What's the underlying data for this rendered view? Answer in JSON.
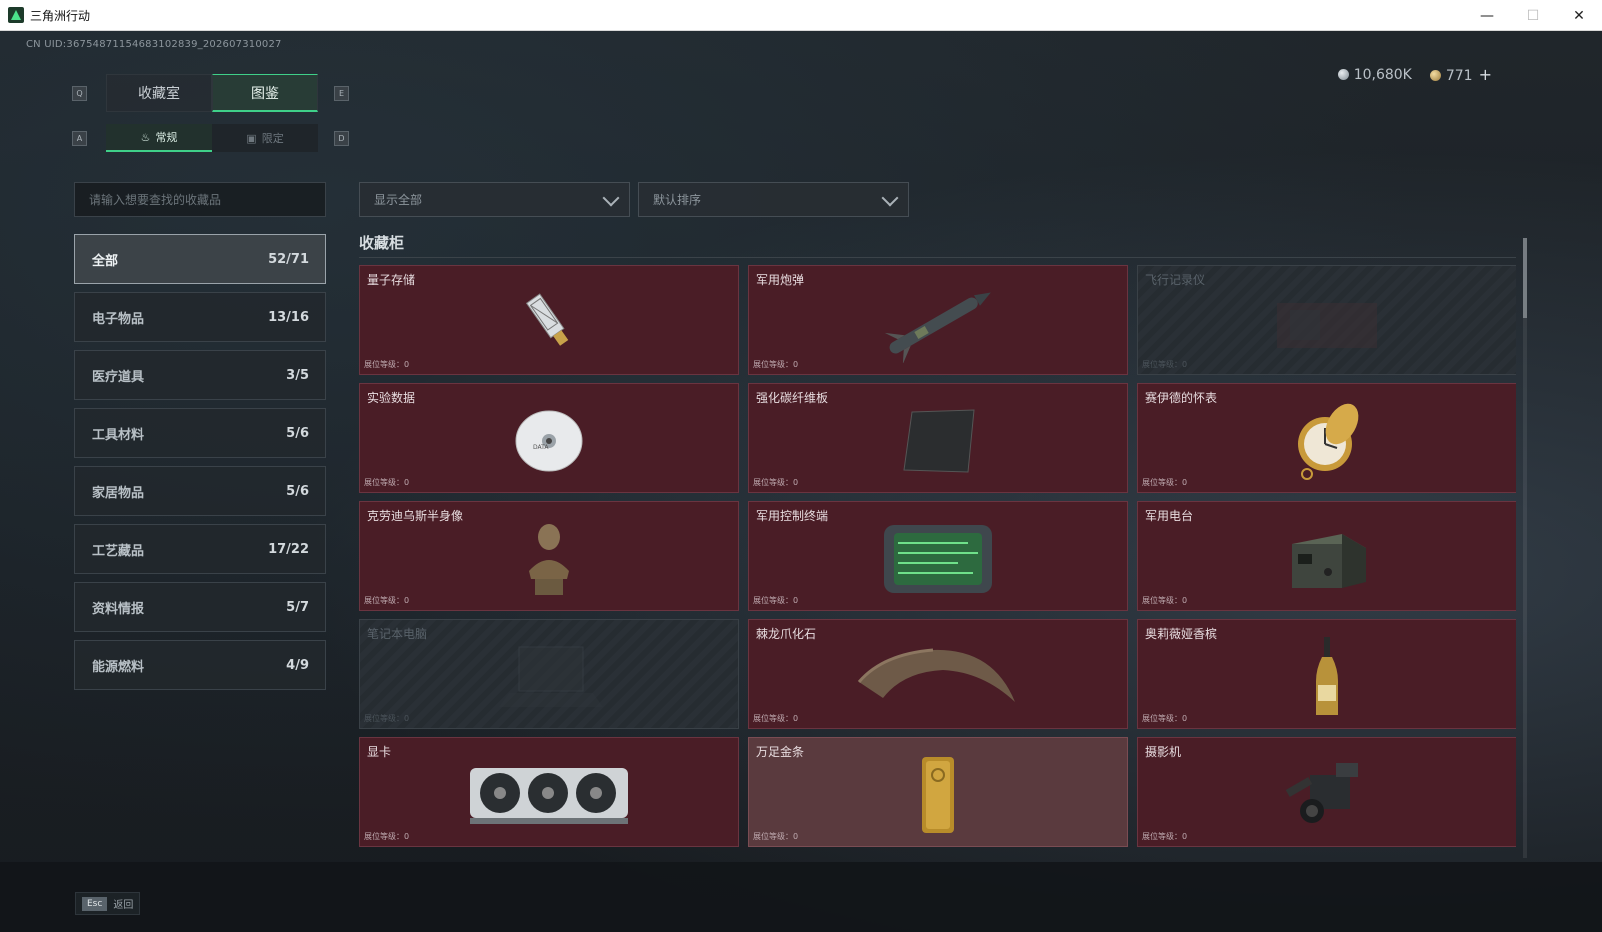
{
  "window": {
    "title": "三角洲行动",
    "minimize": "—",
    "maximize": "☐",
    "close": "✕"
  },
  "uid_text": "CN UID:36754871154683102839_202607310027",
  "currency": {
    "silver": "10,680K",
    "gold": "771",
    "add": "+"
  },
  "tabs": {
    "key_left": "Q",
    "key_right": "E",
    "items": [
      "收藏室",
      "图鉴"
    ],
    "active_index": 1
  },
  "subtabs": {
    "key_left": "A",
    "key_right": "D",
    "items": [
      "常规",
      "限定"
    ],
    "active_index": 0
  },
  "search": {
    "placeholder": "请输入想要查找的收藏品"
  },
  "filters": {
    "show": "显示全部",
    "sort": "默认排序"
  },
  "categories": [
    {
      "label": "全部",
      "count": "52/71",
      "active": true
    },
    {
      "label": "电子物品",
      "count": "13/16"
    },
    {
      "label": "医疗道具",
      "count": "3/5"
    },
    {
      "label": "工具材料",
      "count": "5/6"
    },
    {
      "label": "家居物品",
      "count": "5/6"
    },
    {
      "label": "工艺藏品",
      "count": "17/22"
    },
    {
      "label": "资料情报",
      "count": "5/7"
    },
    {
      "label": "能源燃料",
      "count": "4/9"
    }
  ],
  "section_title": "收藏柜",
  "level_label": "展位等级：0",
  "items": [
    {
      "name": "量子存储",
      "icon": "usb-drive-icon",
      "state": "owned"
    },
    {
      "name": "军用炮弹",
      "icon": "missile-icon",
      "state": "owned"
    },
    {
      "name": "飞行记录仪",
      "icon": "flight-recorder-icon",
      "state": "locked"
    },
    {
      "name": "实验数据",
      "icon": "disc-icon",
      "state": "owned"
    },
    {
      "name": "强化碳纤维板",
      "icon": "carbon-plate-icon",
      "state": "owned"
    },
    {
      "name": "赛伊德的怀表",
      "icon": "pocket-watch-icon",
      "state": "owned"
    },
    {
      "name": "克劳迪乌斯半身像",
      "icon": "bust-icon",
      "state": "owned"
    },
    {
      "name": "军用控制终端",
      "icon": "control-terminal-icon",
      "state": "owned"
    },
    {
      "name": "军用电台",
      "icon": "radio-icon",
      "state": "owned"
    },
    {
      "name": "笔记本电脑",
      "icon": "laptop-icon",
      "state": "locked"
    },
    {
      "name": "棘龙爪化石",
      "icon": "claw-fossil-icon",
      "state": "owned"
    },
    {
      "name": "奥莉薇娅香槟",
      "icon": "champagne-bottle-icon",
      "state": "owned"
    },
    {
      "name": "显卡",
      "icon": "graphics-card-icon",
      "state": "owned"
    },
    {
      "name": "万足金条",
      "icon": "gold-bar-icon",
      "state": "highlight"
    },
    {
      "name": "摄影机",
      "icon": "camera-icon",
      "state": "owned"
    }
  ],
  "footer": {
    "esc_key": "Esc",
    "esc_label": "返回"
  },
  "colors": {
    "accent": "#3fd089",
    "card_owned": "#4a1d26",
    "card_locked": "#2a3036"
  }
}
